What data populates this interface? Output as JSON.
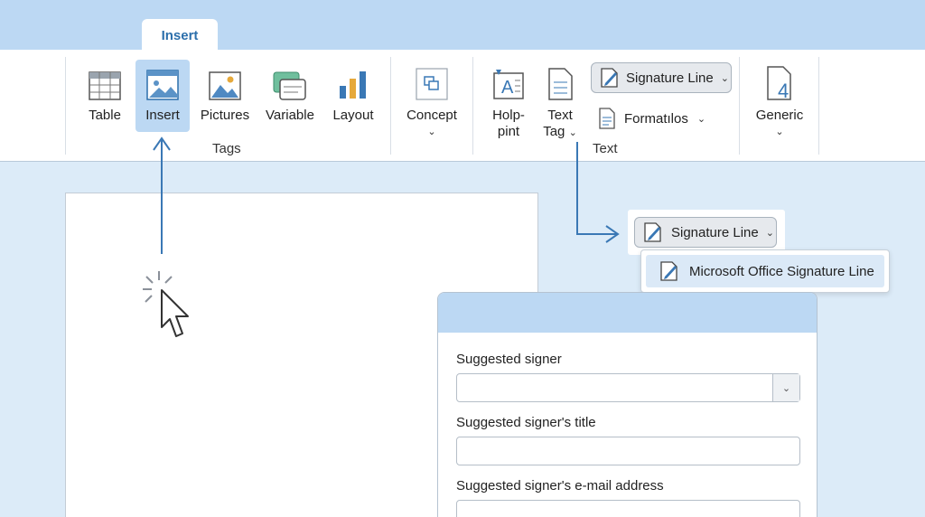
{
  "ribbon": {
    "active_tab": "Insert",
    "groups": {
      "tags": {
        "label": "Tags",
        "buttons": {
          "table": "Table",
          "insert": "Insert",
          "pictures": "Pictures",
          "variable": "Variable",
          "layout": "Layout"
        }
      },
      "concept": {
        "label": "Concept"
      },
      "text": {
        "label": "Text",
        "buttons": {
          "holp_line1": "Holp-",
          "holp_line2": "pint",
          "texttag_line1": "Text",
          "texttag_line2": "Tag",
          "signature_line": "Signature Line",
          "formatilos": "Formatılos"
        }
      },
      "generic": {
        "label": "Generic"
      }
    }
  },
  "flyout": {
    "signature_line": "Signature Line",
    "menu_item": "Microsoft Office Signature Line"
  },
  "dialog": {
    "fields": {
      "signer": {
        "label": "Suggested signer",
        "value": ""
      },
      "title": {
        "label": "Suggested signer's title",
        "value": ""
      },
      "email": {
        "label": "Suggested signer's e-mail address",
        "value": ""
      }
    }
  },
  "colors": {
    "accent": "#2c6fab",
    "arrow": "#3a78b5",
    "ribbon_header": "#bcd8f3",
    "canvas": "#dcebf8"
  }
}
